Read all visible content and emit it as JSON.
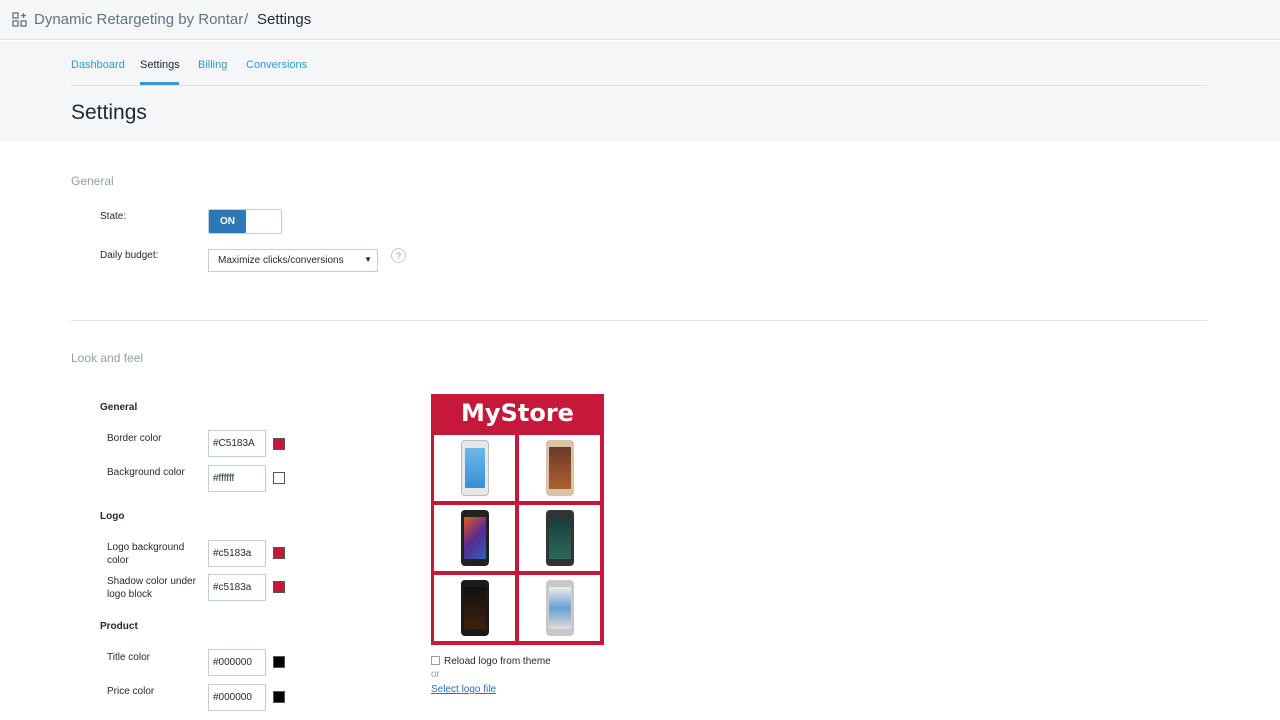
{
  "breadcrumb": {
    "app": "Dynamic Retargeting by Rontar",
    "separator": "/",
    "page": "Settings"
  },
  "tabs": [
    {
      "label": "Dashboard",
      "active": false
    },
    {
      "label": "Settings",
      "active": true
    },
    {
      "label": "Billing",
      "active": false
    },
    {
      "label": "Conversions",
      "active": false
    }
  ],
  "page_title": "Settings",
  "general": {
    "title": "General",
    "state_label": "State:",
    "state_value": "ON",
    "budget_label": "Daily budget:",
    "budget_value": "Maximize clicks/conversions",
    "help": "?"
  },
  "look": {
    "title": "Look and feel",
    "general_head": "General",
    "border_label": "Border color",
    "border_value": "#C5183A",
    "border_swatch": "#c5183a",
    "bg_label": "Background color",
    "bg_value": "#ffffff",
    "bg_swatch": "#ffffff",
    "logo_head": "Logo",
    "logo_bg_label": "Logo background color",
    "logo_bg_value": "#c5183a",
    "logo_bg_swatch": "#c5183a",
    "shadow_label": "Shadow color under logo block",
    "shadow_value": "#c5183a",
    "shadow_swatch": "#c5183a",
    "product_head": "Product",
    "title_label": "Title color",
    "title_value": "#000000",
    "title_swatch": "#000000",
    "price_label": "Price color",
    "price_value": "#000000",
    "price_swatch": "#000000"
  },
  "preview": {
    "logo_text": "MyStore",
    "products": [
      "phone-white-icon",
      "phone-gold-icon",
      "phone-dark-icon",
      "phone-black-icon",
      "phone-xperia-icon",
      "phone-silver-icon"
    ]
  },
  "logo_options": {
    "reload_label": "Reload logo from theme",
    "or": "or",
    "select_link": "Select logo file"
  }
}
